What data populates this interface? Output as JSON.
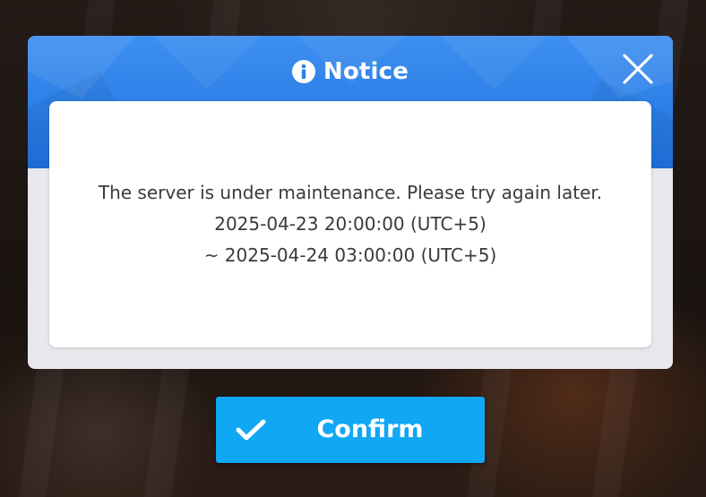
{
  "dialog": {
    "title": "Notice",
    "title_icon": "info-icon",
    "close_icon": "close-icon",
    "message_lines": [
      "The server is under maintenance. Please try again later.",
      "2025-04-23 20:00:00 (UTC+5)",
      "~ 2025-04-24 03:00:00 (UTC+5)"
    ]
  },
  "confirm_button": {
    "label": "Confirm",
    "icon": "checkmark-icon"
  },
  "colors": {
    "header_blue": "#1f72e0",
    "button_blue": "#10a7f4",
    "message_text": "#3a3a3a",
    "panel_gray": "#e8e8ec"
  }
}
